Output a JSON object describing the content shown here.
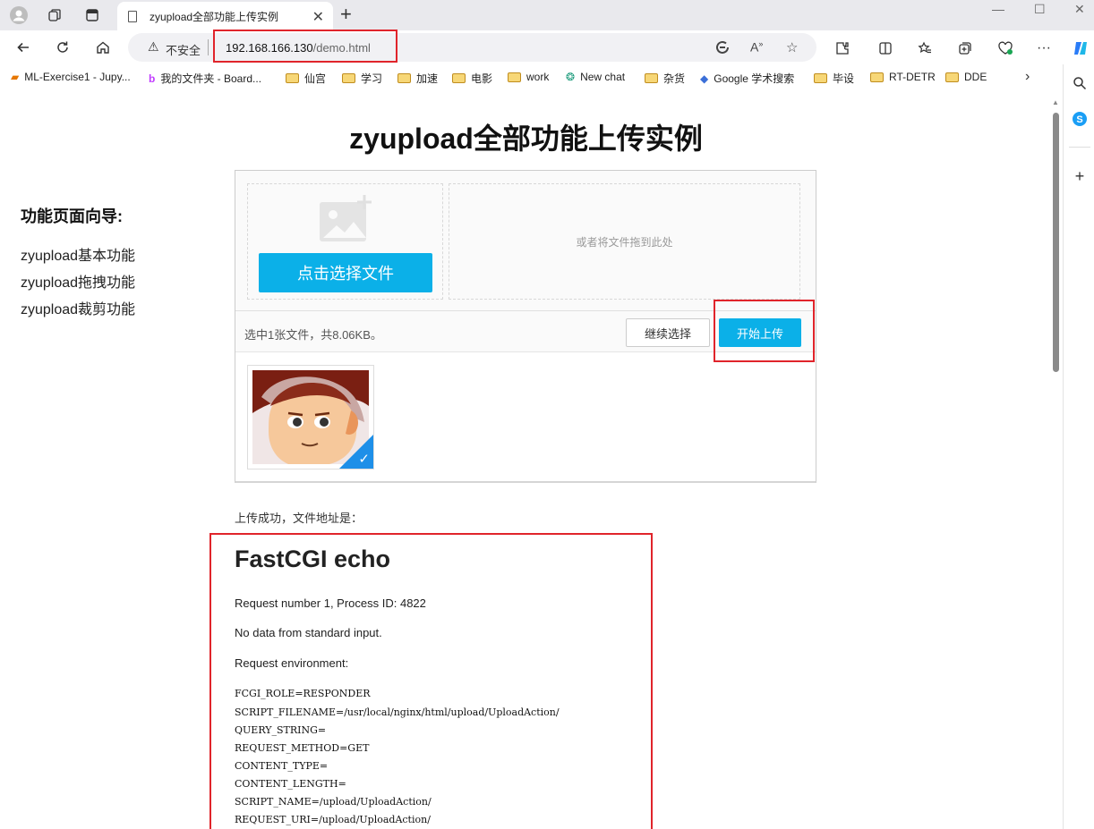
{
  "browser": {
    "tab_title": "zyupload全部功能上传实例",
    "insecure_label": "不安全",
    "url_host": "192.168.166.130",
    "url_path": "/demo.html",
    "highlight_color": "#e0242b"
  },
  "bookmarks": [
    {
      "label": "ML-Exercise1 - Jupy...",
      "icon": "notebook-icon"
    },
    {
      "label": "我的文件夹 - Board...",
      "icon": "board-icon"
    },
    {
      "label": "仙宫",
      "icon": "folder-icon"
    },
    {
      "label": "学习",
      "icon": "folder-icon"
    },
    {
      "label": "加速",
      "icon": "folder-icon"
    },
    {
      "label": "电影",
      "icon": "folder-icon"
    },
    {
      "label": "work",
      "icon": "folder-icon"
    },
    {
      "label": "New chat",
      "icon": "chatgpt-icon"
    },
    {
      "label": "杂货",
      "icon": "folder-icon"
    },
    {
      "label": "Google 学术搜索",
      "icon": "scholar-icon"
    },
    {
      "label": "毕设",
      "icon": "folder-icon"
    },
    {
      "label": "RT-DETR",
      "icon": "folder-icon"
    },
    {
      "label": "DDE",
      "icon": "folder-icon"
    }
  ],
  "page": {
    "title": "zyupload全部功能上传实例",
    "guide_title": "功能页面向导:",
    "guide_links": [
      "zyupload基本功能",
      "zyupload拖拽功能",
      "zyupload裁剪功能"
    ]
  },
  "uploader": {
    "pick_button": "点击选择文件",
    "drop_hint": "或者将文件拖到此处",
    "status": "选中1张文件，共8.06KB。",
    "continue_button": "继续选择",
    "start_button": "开始上传",
    "accent_color": "#0bb0e8"
  },
  "result": {
    "success_label": "上传成功，文件地址是：",
    "heading": "FastCGI echo",
    "request_line": "Request number 1, Process ID: 4822",
    "stdin_line": "No data from standard input.",
    "env_label": "Request environment:",
    "env": [
      "FCGI_ROLE=RESPONDER",
      "SCRIPT_FILENAME=/usr/local/nginx/html/upload/UploadAction/",
      "QUERY_STRING=",
      "REQUEST_METHOD=GET",
      "CONTENT_TYPE=",
      "CONTENT_LENGTH=",
      "SCRIPT_NAME=/upload/UploadAction/",
      "REQUEST_URI=/upload/UploadAction/"
    ]
  }
}
